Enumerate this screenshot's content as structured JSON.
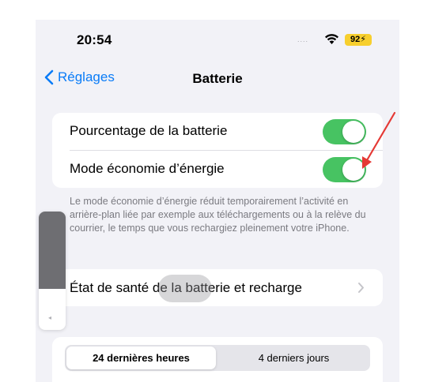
{
  "status_bar": {
    "time": "20:54",
    "signal": "....",
    "wifi_icon": "wifi-icon",
    "battery_label": "92⚡",
    "battery_color": "#f7cf2e"
  },
  "nav": {
    "back_label": "Réglages",
    "title": "Batterie",
    "accent_color": "#0a7cf7"
  },
  "toggles": [
    {
      "label": "Pourcentage de la batterie",
      "on": true
    },
    {
      "label": "Mode économie d’énergie",
      "on": true
    }
  ],
  "toggle_color": "#47c362",
  "footnote": "Le mode économie d’énergie réduit temporairement l’activité en arrière-plan liée par exemple aux téléchargements ou à la relève du courrier, le temps que vous rechargiez pleinement votre iPhone.",
  "health_row": {
    "label": "État de santé de la batterie et recharge"
  },
  "segments": {
    "items": [
      "24 dernières heures",
      "4 derniers jours"
    ],
    "selected": "24 dernières heures"
  },
  "overlays": {
    "arrow_color": "#e53935",
    "volume_level": 0.65
  }
}
